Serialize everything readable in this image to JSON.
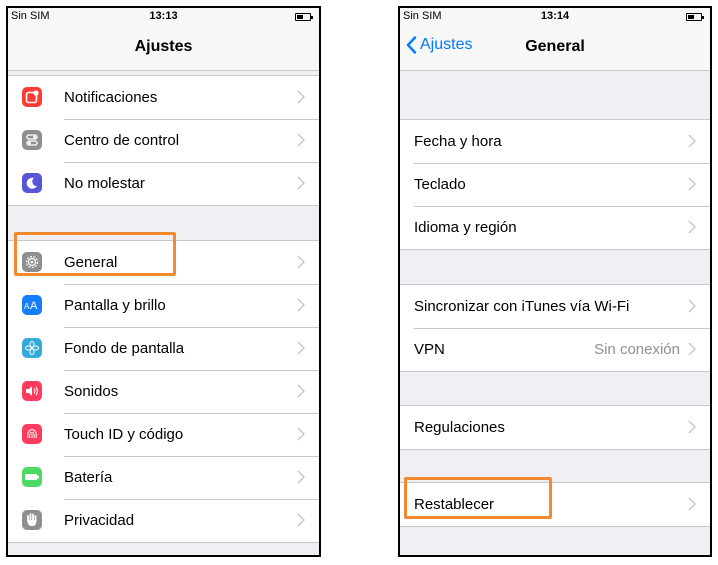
{
  "left": {
    "status": {
      "carrier": "Sin SIM",
      "time": "13:13"
    },
    "title": "Ajustes",
    "groups": [
      [
        {
          "label": "Notificaciones",
          "icon": "notifications-icon",
          "color": "#fe3b30"
        },
        {
          "label": "Centro de control",
          "icon": "control-center-icon",
          "color": "#8e8e93"
        },
        {
          "label": "No molestar",
          "icon": "moon-icon",
          "color": "#5856d6"
        }
      ],
      [
        {
          "label": "General",
          "icon": "gear-icon",
          "color": "#8e8e93"
        },
        {
          "label": "Pantalla y brillo",
          "icon": "text-size-icon",
          "color": "#147efb"
        },
        {
          "label": "Fondo de pantalla",
          "icon": "flower-icon",
          "color": "#34aadc"
        },
        {
          "label": "Sonidos",
          "icon": "speaker-icon",
          "color": "#fe3b5c"
        },
        {
          "label": "Touch ID y código",
          "icon": "fingerprint-icon",
          "color": "#fe3b5c"
        },
        {
          "label": "Batería",
          "icon": "battery-icon",
          "color": "#4cd964"
        },
        {
          "label": "Privacidad",
          "icon": "hand-icon",
          "color": "#8e8e93"
        }
      ]
    ]
  },
  "right": {
    "status": {
      "carrier": "Sin SIM",
      "time": "13:14"
    },
    "back_label": "Ajustes",
    "title": "General",
    "groups": [
      [
        {
          "label": "Fecha y hora"
        },
        {
          "label": "Teclado"
        },
        {
          "label": "Idioma y región"
        }
      ],
      [
        {
          "label": "Sincronizar con iTunes vía Wi-Fi"
        },
        {
          "label": "VPN",
          "value": "Sin conexión"
        }
      ],
      [
        {
          "label": "Regulaciones"
        }
      ],
      [
        {
          "label": "Restablecer"
        }
      ]
    ]
  },
  "highlight_color": "#f28a30"
}
